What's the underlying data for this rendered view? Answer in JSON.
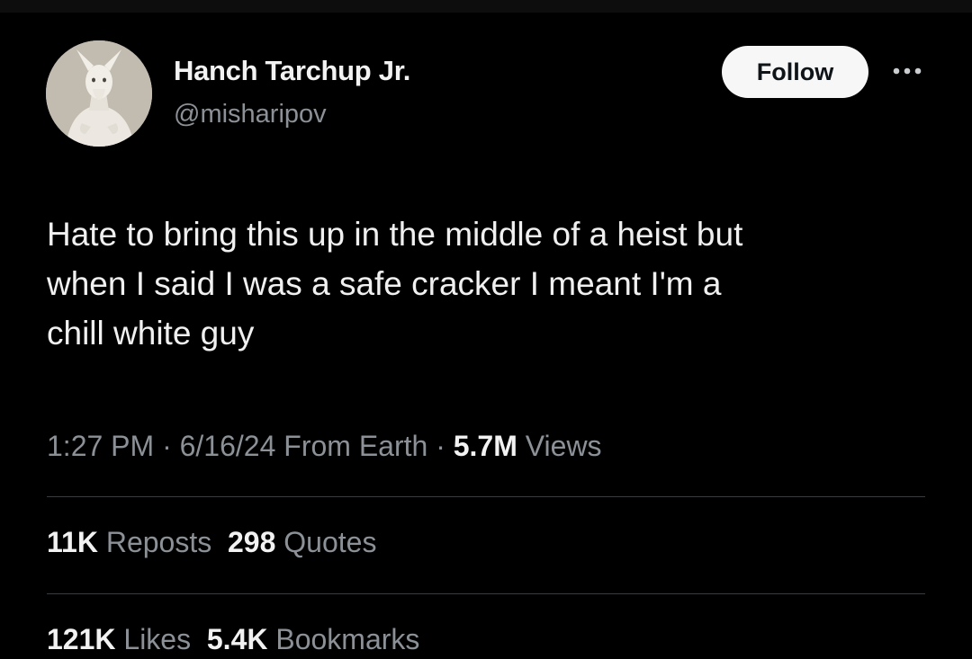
{
  "author": {
    "display_name": "Hanch Tarchup Jr.",
    "handle": "@misharipov",
    "avatar_icon": "kangaroo-avatar"
  },
  "actions": {
    "follow_label": "Follow",
    "more_icon": "more-horizontal-icon"
  },
  "tweet": {
    "lines": [
      "Hate to bring this up in the middle of a heist but",
      "when I said I was a safe cracker I meant I'm a",
      "chill white guy"
    ]
  },
  "meta": {
    "time": "1:27 PM",
    "separator": "·",
    "date": "6/16/24",
    "source": "From Earth",
    "views_count": "5.7M",
    "views_label": "Views"
  },
  "stats": {
    "reposts_count": "11K",
    "reposts_label": "Reposts",
    "quotes_count": "298",
    "quotes_label": "Quotes",
    "likes_count": "121K",
    "likes_label": "Likes",
    "bookmarks_count": "5.4K",
    "bookmarks_label": "Bookmarks"
  },
  "colors": {
    "background": "#000000",
    "primary_text": "#f2f2f2",
    "secondary_text": "#8b9197",
    "divider": "#3a3d40",
    "follow_button_bg": "#f7f7f7"
  }
}
